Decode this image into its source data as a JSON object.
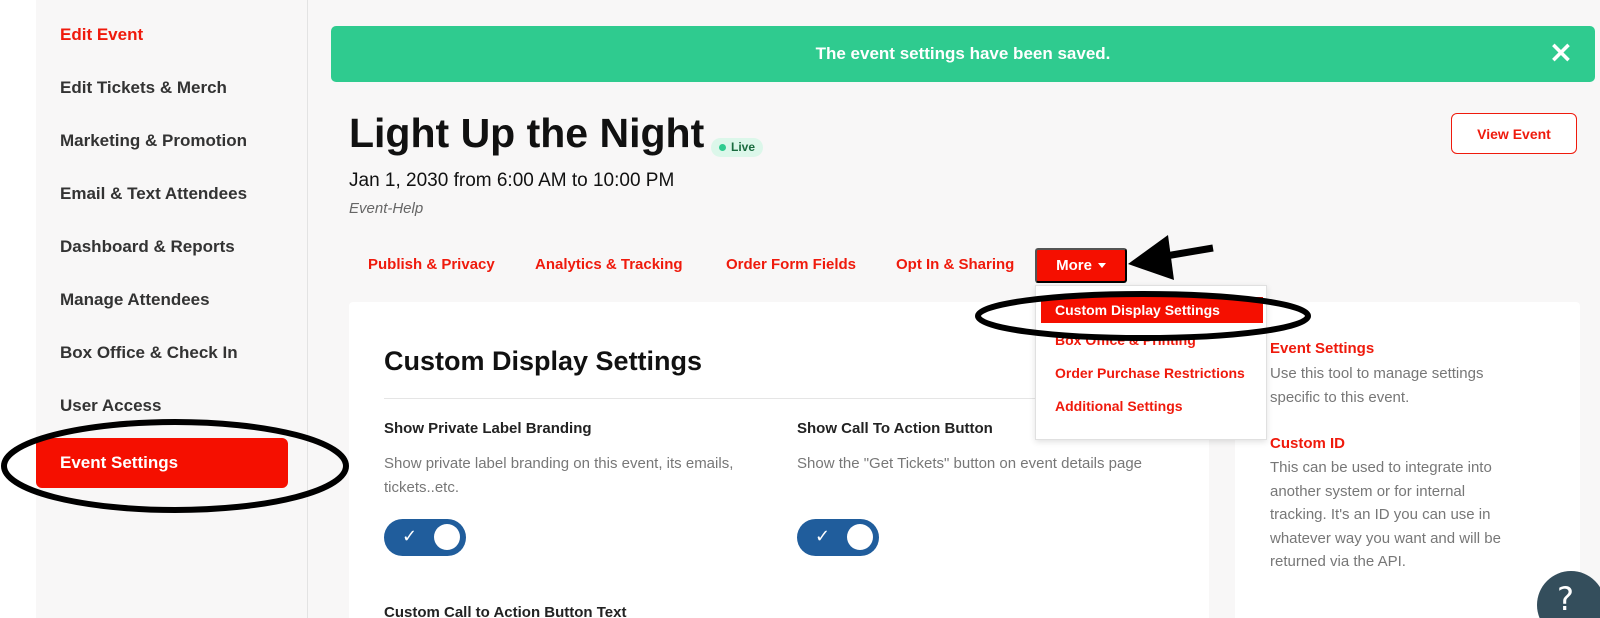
{
  "sidebar": {
    "items": [
      {
        "label": "Edit Event"
      },
      {
        "label": "Edit Tickets & Merch"
      },
      {
        "label": "Marketing & Promotion"
      },
      {
        "label": "Email & Text Attendees"
      },
      {
        "label": "Dashboard & Reports"
      },
      {
        "label": "Manage Attendees"
      },
      {
        "label": "Box Office & Check In"
      },
      {
        "label": "User Access"
      },
      {
        "label": "Event Settings"
      }
    ]
  },
  "alert": {
    "message": "The event settings have been saved.",
    "close_symbol": "×"
  },
  "event": {
    "title": "Light Up the Night",
    "status": "Live",
    "date": "Jan 1, 2030 from 6:00 AM to 10:00 PM",
    "organizer": "Event-Help",
    "view_button": "View Event"
  },
  "tabs": {
    "items": [
      {
        "label": "Publish & Privacy"
      },
      {
        "label": "Analytics & Tracking"
      },
      {
        "label": "Order Form Fields"
      },
      {
        "label": "Opt In & Sharing"
      }
    ],
    "more_label": "More"
  },
  "dropdown": {
    "items": [
      {
        "label": "Custom Display Settings"
      },
      {
        "label": "Box Office & Printing"
      },
      {
        "label": "Order Purchase Restrictions"
      },
      {
        "label": "Additional Settings"
      }
    ]
  },
  "main": {
    "title": "Custom Display Settings",
    "settings": [
      {
        "label": "Show Private Label Branding",
        "description": "Show private label branding on this event, its emails, tickets..etc.",
        "enabled": true
      },
      {
        "label": "Show Call To Action Button",
        "description": "Show the \"Get Tickets\" button on event details page",
        "enabled": true
      }
    ],
    "cta_text_label": "Custom Call to Action Button Text"
  },
  "info": {
    "sections": [
      {
        "heading": "Event Settings",
        "text": "Use this tool to manage settings specific to this event."
      },
      {
        "heading": "Custom ID",
        "text": "This can be used to integrate into another system or for internal tracking. It's an ID you can use in whatever way you want and will be returned via the API."
      }
    ]
  },
  "help": {
    "symbol": "?"
  },
  "icons": {
    "toggle_check": "✓",
    "close": "close-icon",
    "caret": "chevron-down-icon"
  },
  "colors": {
    "accent": "#f50f00",
    "link": "#ef1a0c",
    "success": "#2fcb8f",
    "toggle": "#205d9c",
    "help": "#344e5c"
  }
}
